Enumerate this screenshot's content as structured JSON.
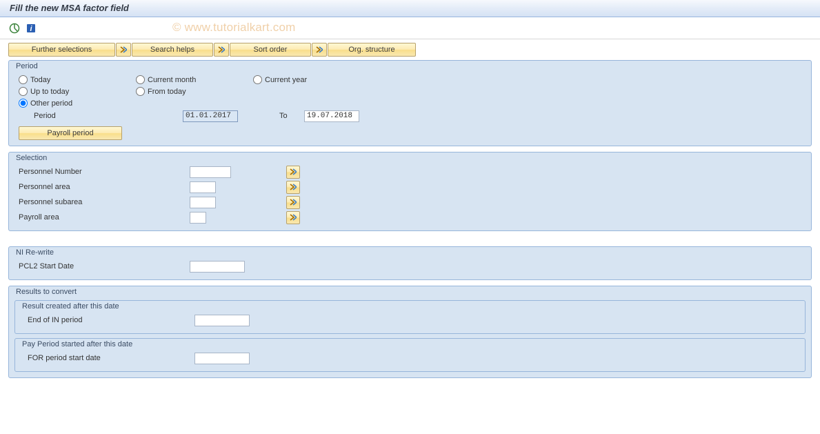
{
  "title": "Fill the new MSA factor field",
  "watermark": "© www.tutorialkart.com",
  "buttons": {
    "further_selections": "Further selections",
    "search_helps": "Search helps",
    "sort_order": "Sort order",
    "org_structure": "Org. structure",
    "payroll_period": "Payroll period"
  },
  "groups": {
    "period": {
      "title": "Period",
      "radios": {
        "today": "Today",
        "current_month": "Current month",
        "current_year": "Current year",
        "up_to_today": "Up to today",
        "from_today": "From today",
        "other_period": "Other period"
      },
      "period_label": "Period",
      "from_value": "01.01.2017",
      "to_label": "To",
      "to_value": "19.07.2018"
    },
    "selection": {
      "title": "Selection",
      "rows": {
        "pernr": "Personnel Number",
        "parea": "Personnel area",
        "psubarea": "Personnel subarea",
        "payarea": "Payroll area"
      }
    },
    "ni_rewrite": {
      "title": "NI Re-write",
      "row": "PCL2 Start Date"
    },
    "results": {
      "title": "Results to convert",
      "sub1_title": "Result created after this date",
      "sub1_row": "End of IN period",
      "sub2_title": "Pay Period started after this date",
      "sub2_row": "FOR period start date"
    }
  }
}
